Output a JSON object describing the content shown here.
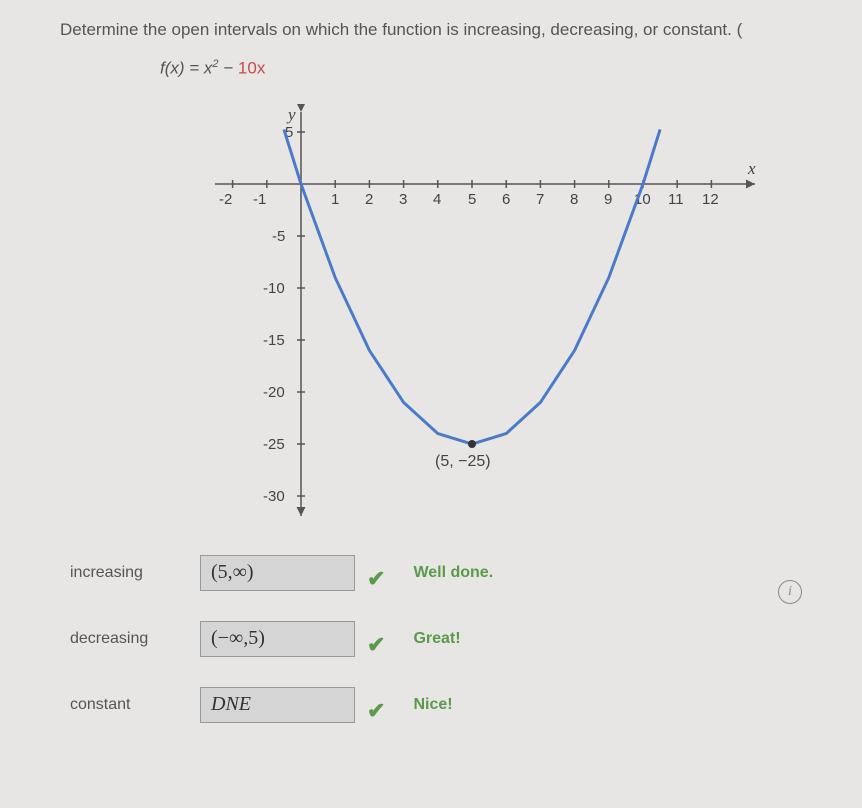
{
  "question": "Determine the open intervals on which the function is increasing, decreasing, or constant. (",
  "function": {
    "lhs": "f(x) = x",
    "exp": "2",
    "minus": " − ",
    "term": "10x"
  },
  "chart_data": {
    "type": "line",
    "title": "",
    "xlabel": "x",
    "ylabel": "y",
    "x_ticks": [
      -2,
      -1,
      1,
      2,
      3,
      4,
      5,
      6,
      7,
      8,
      9,
      10,
      11,
      12
    ],
    "y_ticks": [
      5,
      -5,
      -10,
      -15,
      -20,
      -25,
      -30
    ],
    "xlim": [
      -2.5,
      12.5
    ],
    "ylim": [
      -32,
      8
    ],
    "series": [
      {
        "name": "f(x) = x^2 - 10x",
        "x": [
          -0.5,
          0,
          1,
          2,
          3,
          4,
          5,
          6,
          7,
          8,
          9,
          10,
          10.5
        ],
        "values": [
          5.25,
          0,
          -9,
          -16,
          -21,
          -24,
          -25,
          -24,
          -21,
          -16,
          -9,
          0,
          5.25
        ]
      }
    ],
    "vertex": {
      "x": 5,
      "y": -25,
      "label": "(5, −25)"
    }
  },
  "answers": {
    "rows": [
      {
        "label": "increasing",
        "value": "(5,∞)",
        "feedback": "Well done."
      },
      {
        "label": "decreasing",
        "value": "(−∞,5)",
        "feedback": "Great!"
      },
      {
        "label": "constant",
        "value": "DNE",
        "feedback": "Nice!"
      }
    ]
  },
  "info_icon": "i"
}
